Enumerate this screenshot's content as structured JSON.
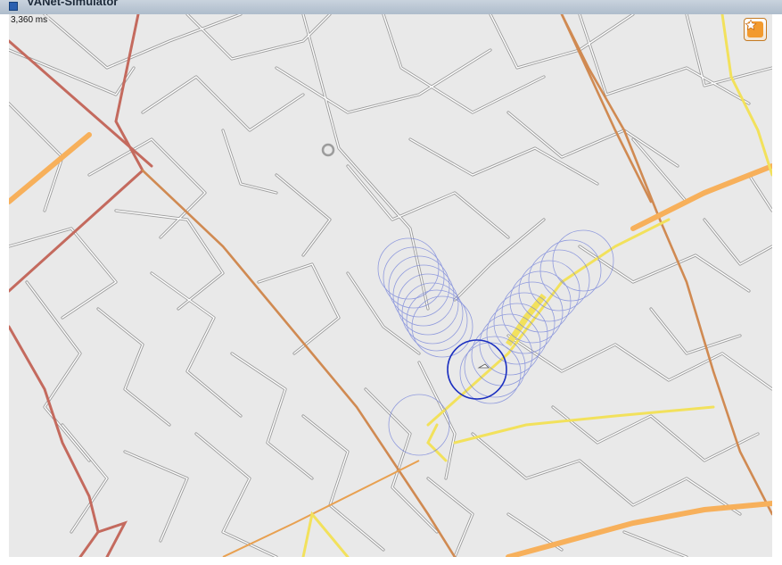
{
  "window": {
    "title": "VANet-Simulator"
  },
  "status": {
    "sim_time": "3,360 ms"
  },
  "toolbar": {
    "favorite_icon": "star-icon"
  },
  "colors": {
    "map_background": "#e9e9e9",
    "street_casing": "#9c9c9c",
    "street_fill": "#ffffff",
    "major_road": "#d08a52",
    "primary_road": "#f7b05b",
    "secondary_road": "#f2e15c",
    "trunk_road": "#c46a5e",
    "range_circle": "#6c7bd8",
    "active_range_circle": "#1b2fc0"
  }
}
